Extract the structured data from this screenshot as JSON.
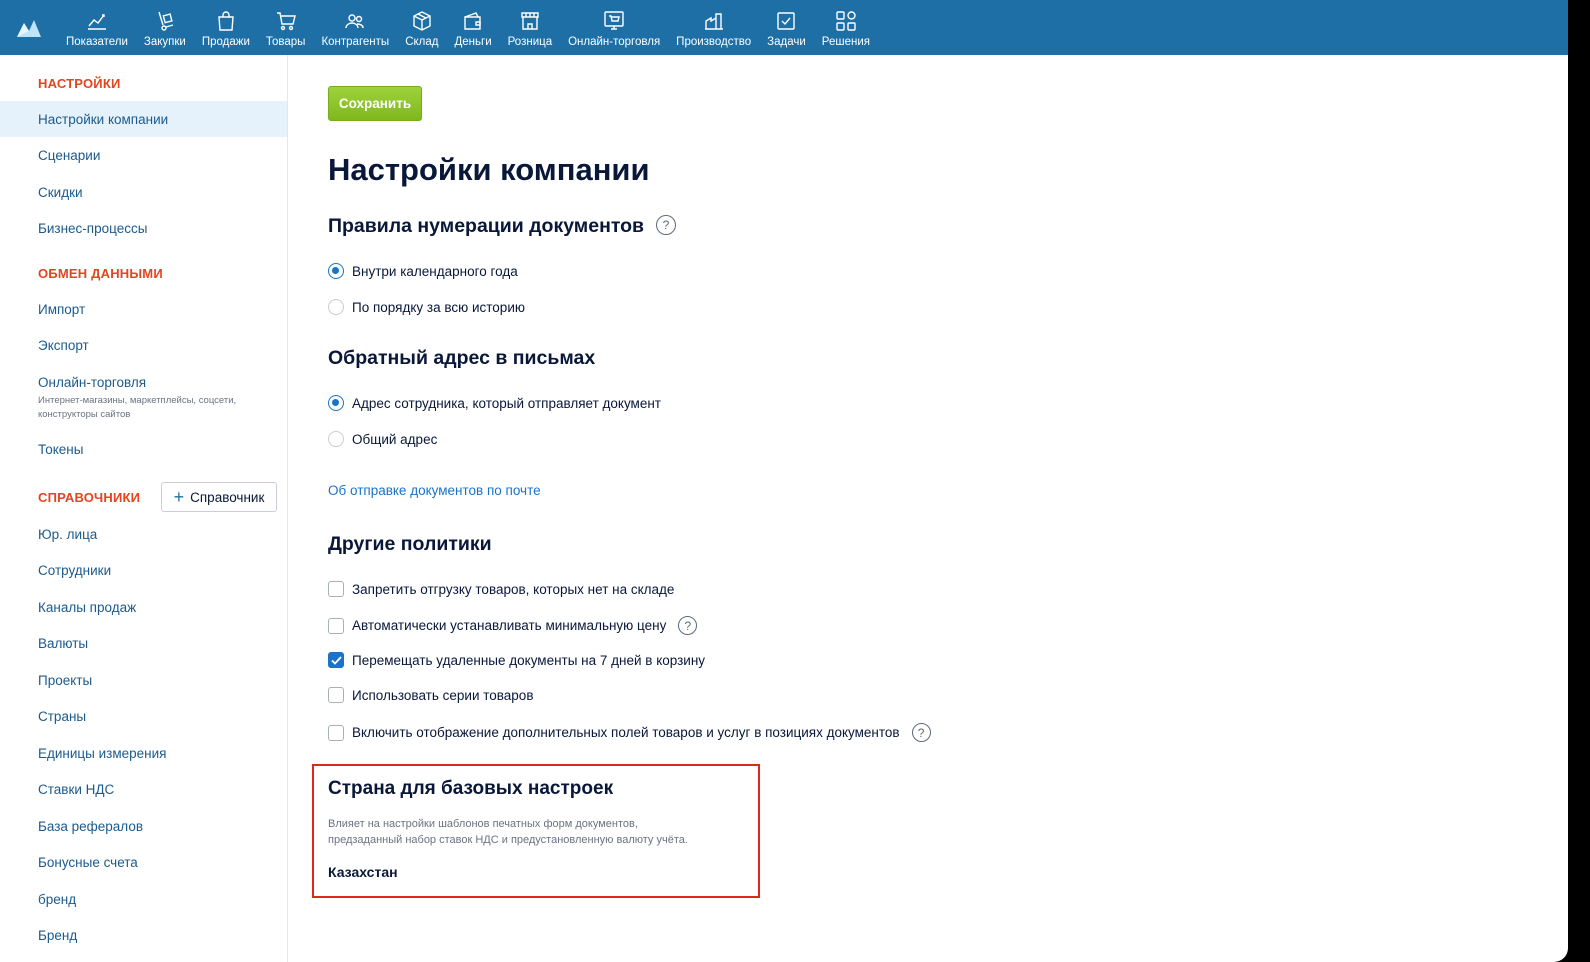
{
  "nav": [
    {
      "label": "Показатели",
      "icon": "chart-line-icon"
    },
    {
      "label": "Закупки",
      "icon": "hand-truck-icon"
    },
    {
      "label": "Продажи",
      "icon": "shopping-bag-icon"
    },
    {
      "label": "Товары",
      "icon": "cart-icon"
    },
    {
      "label": "Контрагенты",
      "icon": "people-icon"
    },
    {
      "label": "Склад",
      "icon": "box-icon"
    },
    {
      "label": "Деньги",
      "icon": "wallet-icon"
    },
    {
      "label": "Розница",
      "icon": "store-icon"
    },
    {
      "label": "Онлайн-торговля",
      "icon": "online-cart-icon"
    },
    {
      "label": "Производство",
      "icon": "factory-icon"
    },
    {
      "label": "Задачи",
      "icon": "task-check-icon"
    },
    {
      "label": "Решения",
      "icon": "grid-apps-icon"
    }
  ],
  "sidebar": {
    "settings_header": "НАСТРОЙКИ",
    "settings_items": [
      "Настройки компании",
      "Сценарии",
      "Скидки",
      "Бизнес-процессы"
    ],
    "exchange_header": "ОБМЕН ДАННЫМИ",
    "exchange_items": [
      "Импорт",
      "Экспорт",
      "Онлайн-торговля",
      "Токены"
    ],
    "online_sub": "Интернет-магазины, маркетплейсы, соцсети, конструкторы сайтов",
    "directories_header": "СПРАВОЧНИКИ",
    "add_directory": "Справочник",
    "directory_items": [
      "Юр. лица",
      "Сотрудники",
      "Каналы продаж",
      "Валюты",
      "Проекты",
      "Страны",
      "Единицы измерения",
      "Ставки НДС",
      "База рефералов",
      "Бонусные счета",
      "бренд",
      "Бренд"
    ]
  },
  "main": {
    "save_label": "Сохранить",
    "page_title": "Настройки компании",
    "numbering": {
      "title": "Правила нумерации документов",
      "options": [
        "Внутри календарного года",
        "По порядку за всю историю"
      ],
      "selected": 0
    },
    "return_address": {
      "title": "Обратный адрес в письмах",
      "options": [
        "Адрес сотрудника, который отправляет документ",
        "Общий адрес"
      ],
      "selected": 0
    },
    "mail_link": "Об отправке документов по почте",
    "other_policies": {
      "title": "Другие политики",
      "items": [
        {
          "label": "Запретить отгрузку товаров, которых нет на складе",
          "checked": false,
          "help": false
        },
        {
          "label": "Автоматически устанавливать минимальную цену",
          "checked": false,
          "help": true
        },
        {
          "label": "Перемещать удаленные документы на 7 дней в корзину",
          "checked": true,
          "help": false
        },
        {
          "label": "Использовать серии товаров",
          "checked": false,
          "help": false
        },
        {
          "label": "Включить отображение дополнительных полей товаров и услуг в позициях документов",
          "checked": false,
          "help": true
        }
      ]
    },
    "country": {
      "title": "Страна для базовых настроек",
      "desc_line1": "Влияет на настройки шаблонов печатных форм документов,",
      "desc_line2": "предзаданный набор ставок НДС и предустановленную валюту учёта.",
      "value": "Казахстан"
    }
  },
  "colors": {
    "topbar": "#1d6fa5",
    "section_header": "#e2461f",
    "link": "#1a73c9",
    "save": "#8cc42a",
    "highlight_border": "#e3261c"
  }
}
